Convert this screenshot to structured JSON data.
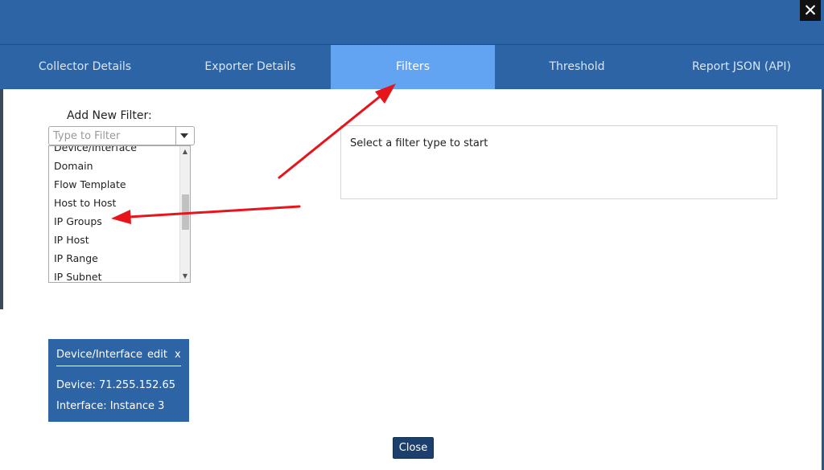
{
  "modal": {
    "close_glyph": "✕"
  },
  "tabs": [
    {
      "label": "Collector Details",
      "active": false
    },
    {
      "label": "Exporter Details",
      "active": false
    },
    {
      "label": "Filters",
      "active": true
    },
    {
      "label": "Threshold",
      "active": false
    },
    {
      "label": "Report JSON (API)",
      "active": false
    }
  ],
  "filter_panel": {
    "label": "Add New Filter:",
    "search_placeholder": "Type to Filter",
    "items": [
      "Device/Interface",
      "Domain",
      "Flow Template",
      "Host to Host",
      "IP Groups",
      "IP Host",
      "IP Range",
      "IP Subnet"
    ]
  },
  "info": {
    "text": "Select a filter type to start"
  },
  "active_filter": {
    "title": "Device/Interface",
    "edit_label": "edit",
    "remove_label": "x",
    "device": "Device: 71.255.152.65",
    "interface": "Interface: Instance 3"
  },
  "footer": {
    "close_label": "Close"
  },
  "colors": {
    "header_blue": "#2c64a6",
    "active_tab": "#62a3f2",
    "close_button": "#1c3f6e",
    "annotation_arrow": "#e8141b"
  },
  "icons": [
    "close-icon",
    "chevron-down-icon",
    "scroll-up-icon",
    "scroll-down-icon",
    "annotation-arrow"
  ]
}
